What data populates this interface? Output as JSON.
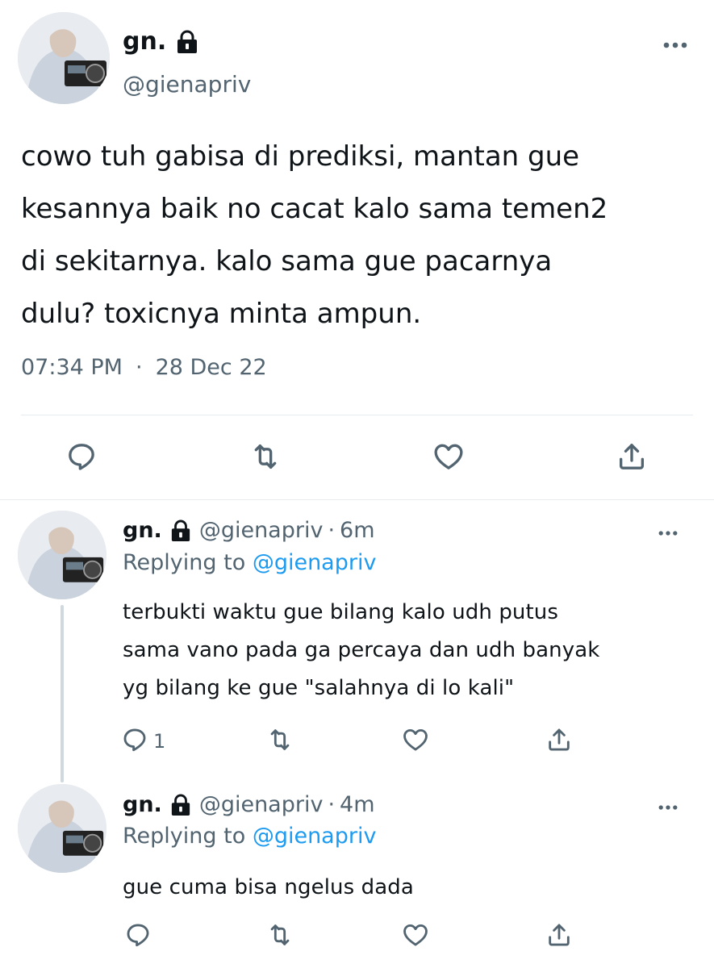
{
  "main_tweet": {
    "display_name": "gn.",
    "handle": "@gienapriv",
    "text_lines": [
      "cowo tuh gabisa di prediksi, mantan gue",
      "kesannya baik no cacat kalo sama temen2",
      "di sekitarnya. kalo sama gue pacarnya",
      "dulu? toxicnya minta ampun."
    ],
    "time": "07:34 PM",
    "separator": "·",
    "date": "28 Dec 22"
  },
  "replies": [
    {
      "display_name": "gn.",
      "handle": "@gienapriv",
      "separator": "·",
      "age": "6m",
      "replying_label": "Replying to",
      "replying_handle": "@gienapriv",
      "text_lines": [
        "terbukti waktu gue bilang kalo udh putus",
        "sama vano pada ga percaya dan udh banyak",
        "yg bilang ke gue \"salahnya di lo kali\""
      ],
      "reply_count": "1"
    },
    {
      "display_name": "gn.",
      "handle": "@gienapriv",
      "separator": "·",
      "age": "4m",
      "replying_label": "Replying to",
      "replying_handle": "@gienapriv",
      "text_lines": [
        "gue cuma bisa ngelus dada"
      ],
      "reply_count": ""
    }
  ],
  "icons": {
    "more": "more-dots-icon",
    "lock": "lock-icon",
    "reply": "reply-bubble-icon",
    "retweet": "retweet-icon",
    "like": "heart-icon",
    "share": "share-icon"
  },
  "colors": {
    "text": "#0f1419",
    "muted": "#536471",
    "link": "#1d9bf0",
    "divider": "#e6ecf0",
    "thread_line": "#cfd9de"
  }
}
